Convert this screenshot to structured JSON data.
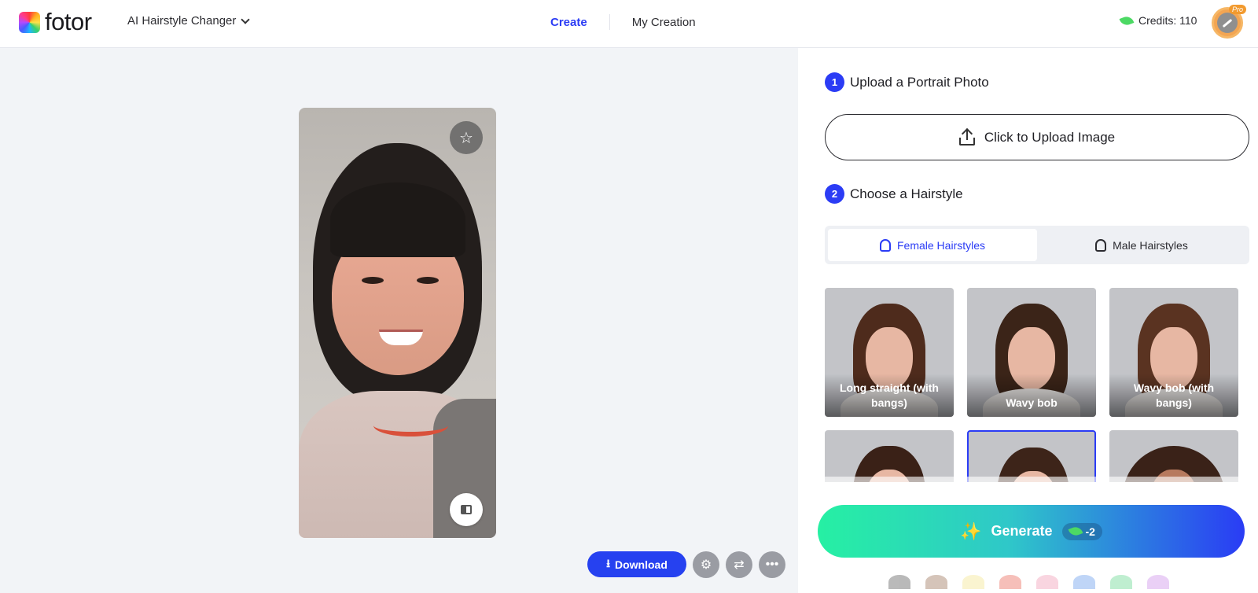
{
  "header": {
    "brand": "fotor",
    "tool_select": "AI Hairstyle Changer",
    "nav": {
      "create": "Create",
      "my_creation": "My Creation"
    },
    "credits": "Credits: 110",
    "pro_badge": "Pro"
  },
  "canvas": {
    "download_label": "Download",
    "icons": [
      "star-icon",
      "compare-icon",
      "adjust-icon",
      "share-icon",
      "more-icon"
    ]
  },
  "panel": {
    "step1": {
      "num": "1",
      "title": "Upload a Portrait Photo"
    },
    "upload_label": "Click to Upload Image",
    "step2": {
      "num": "2",
      "title": "Choose a Hairstyle"
    },
    "tabs": [
      {
        "label": "Female Hairstyles",
        "active": true
      },
      {
        "label": "Male Hairstyles",
        "active": false
      }
    ],
    "hairstyles": [
      {
        "label": "Long straight (with bangs)",
        "hair": "#4e2b1c"
      },
      {
        "label": "Wavy bob",
        "hair": "#3b2418"
      },
      {
        "label": "Wavy bob (with bangs)",
        "hair": "#5a3321"
      },
      {
        "label": "",
        "hair": "#3a2117"
      },
      {
        "label": "",
        "hair": "#3d2419"
      },
      {
        "label": "",
        "hair": "#3a2218"
      }
    ],
    "generate_label": "Generate",
    "generate_cost": "-2"
  },
  "colors": {
    "accent": "#2b3cf5",
    "generate_start": "#26f0a3",
    "generate_end": "#2a3cf5"
  }
}
